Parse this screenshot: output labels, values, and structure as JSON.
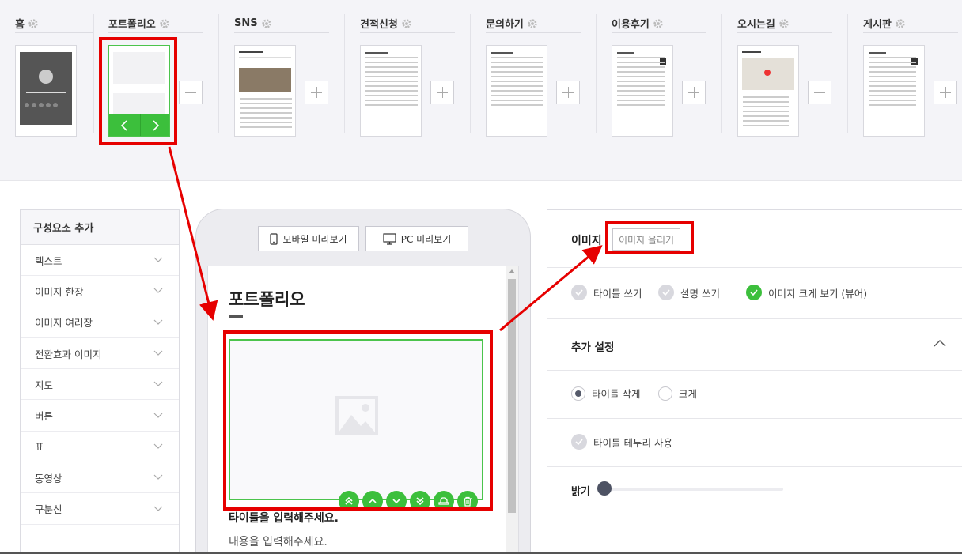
{
  "pages": [
    {
      "label": "홈"
    },
    {
      "label": "포트폴리오"
    },
    {
      "label": "SNS"
    },
    {
      "label": "견적신청"
    },
    {
      "label": "문의하기"
    },
    {
      "label": "이용후기"
    },
    {
      "label": "오시는길"
    },
    {
      "label": "게시판"
    }
  ],
  "components": {
    "title": "구성요소 추가",
    "items": [
      {
        "label": "텍스트"
      },
      {
        "label": "이미지 한장"
      },
      {
        "label": "이미지 여러장"
      },
      {
        "label": "전환효과 이미지"
      },
      {
        "label": "지도"
      },
      {
        "label": "버튼"
      },
      {
        "label": "표"
      },
      {
        "label": "동영상"
      },
      {
        "label": "구분선"
      }
    ]
  },
  "preview": {
    "mobile_label": "모바일 미리보기",
    "pc_label": "PC 미리보기",
    "page_heading": "포트폴리오",
    "title_placeholder": "타이틀을 입력해주세요.",
    "body_placeholder": "내용을 입력해주세요."
  },
  "settings": {
    "image_label": "이미지",
    "upload_label": "이미지 올리기",
    "checks": [
      {
        "label": "타이틀 쓰기",
        "checked": false
      },
      {
        "label": "설명 쓰기",
        "checked": false
      },
      {
        "label": "이미지 크게 보기 (뷰어)",
        "checked": true
      }
    ],
    "extra_title": "추가 설정",
    "title_size": {
      "small": "타이틀 작게",
      "large": "크게",
      "selected": "small"
    },
    "border_label": "타이틀 테두리 사용",
    "brightness_label": "밝기",
    "brightness": 0
  },
  "colors": {
    "accent_green": "#3cbf3c",
    "annotation_red": "#e60000"
  }
}
